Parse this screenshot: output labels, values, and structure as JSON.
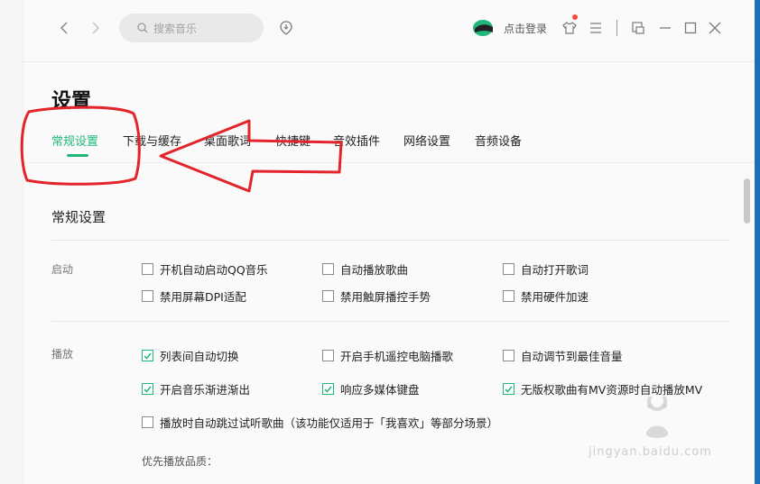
{
  "titlebar": {
    "search_placeholder": "搜索音乐",
    "login_label": "点击登录"
  },
  "page": {
    "title": "设置"
  },
  "tabs": [
    {
      "label": "常规设置",
      "active": true
    },
    {
      "label": "下载与缓存",
      "active": false
    },
    {
      "label": "桌面歌词",
      "active": false
    },
    {
      "label": "快捷键",
      "active": false
    },
    {
      "label": "音效插件",
      "active": false
    },
    {
      "label": "网络设置",
      "active": false
    },
    {
      "label": "音频设备",
      "active": false
    }
  ],
  "section": {
    "title": "常规设置"
  },
  "startup": {
    "label": "启动",
    "options": [
      {
        "label": "开机自动启动QQ音乐",
        "checked": false
      },
      {
        "label": "自动播放歌曲",
        "checked": false
      },
      {
        "label": "自动打开歌词",
        "checked": false
      },
      {
        "label": "禁用屏幕DPI适配",
        "checked": false
      },
      {
        "label": "禁用触屏播控手势",
        "checked": false
      },
      {
        "label": "禁用硬件加速",
        "checked": false
      }
    ]
  },
  "playback": {
    "label": "播放",
    "options": [
      {
        "label": "列表间自动切换",
        "checked": true
      },
      {
        "label": "开启手机遥控电脑播歌",
        "checked": false
      },
      {
        "label": "自动调节到最佳音量",
        "checked": false
      },
      {
        "label": "开启音乐渐进渐出",
        "checked": true
      },
      {
        "label": "响应多媒体键盘",
        "checked": true
      },
      {
        "label": "无版权歌曲有MV资源时自动播放MV",
        "checked": true
      },
      {
        "label": "播放时自动跳过试听歌曲（该功能仅适用于「我喜欢」等部分场景）",
        "checked": false
      }
    ],
    "quality_label": "优先播放品质："
  },
  "watermark": {
    "text": "jingyan.baidu.com"
  },
  "colors": {
    "accent": "#1fb87a",
    "annotation": "#e3242b"
  },
  "icons": [
    "back-arrow-icon",
    "forward-arrow-icon",
    "search-icon",
    "listen-recognize-icon",
    "avatar-icon",
    "skin-shirt-icon",
    "menu-icon",
    "mini-mode-icon",
    "minimize-icon",
    "maximize-icon",
    "close-icon"
  ]
}
